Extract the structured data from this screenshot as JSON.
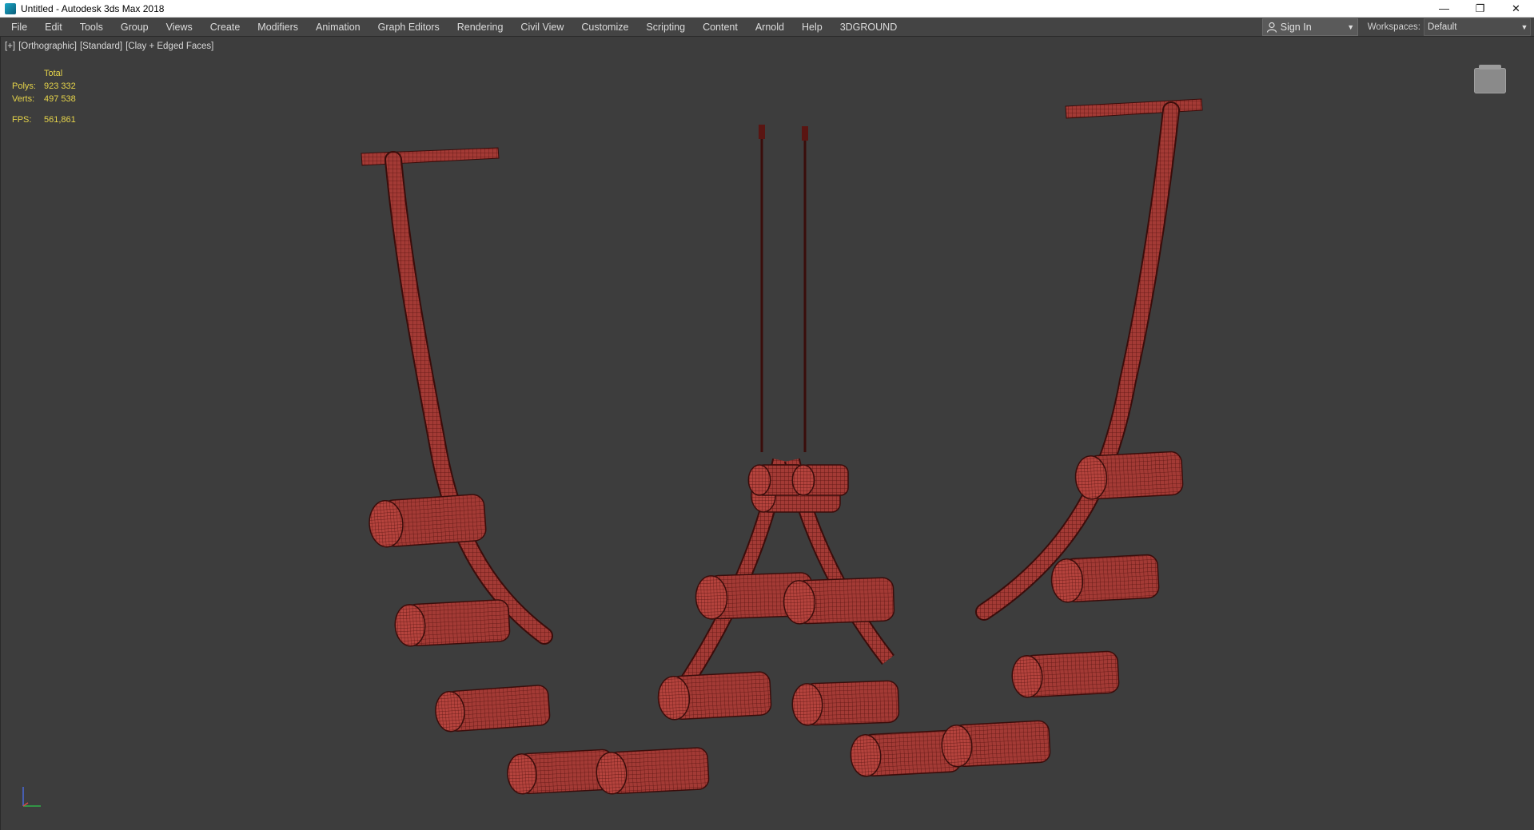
{
  "window": {
    "title": "Untitled - Autodesk 3ds Max 2018",
    "minimize": "—",
    "restore": "❐",
    "close": "✕"
  },
  "menu": {
    "items": [
      "File",
      "Edit",
      "Tools",
      "Group",
      "Views",
      "Create",
      "Modifiers",
      "Animation",
      "Graph Editors",
      "Rendering",
      "Civil View",
      "Customize",
      "Scripting",
      "Content",
      "Arnold",
      "Help",
      "3DGROUND"
    ],
    "sign_in": "Sign In",
    "workspaces_label": "Workspaces:",
    "workspace_value": "Default"
  },
  "viewport": {
    "labels": [
      "[+]",
      "[Orthographic]",
      "[Standard]",
      "[Clay + Edged Faces]"
    ],
    "stats": {
      "header": "Total",
      "polys_label": "Polys:",
      "polys_value": "923 332",
      "verts_label": "Verts:",
      "verts_value": "497 538",
      "fps_label": "FPS:",
      "fps_value": "561,861"
    },
    "object_color": "#a33a35",
    "edge_color": "#5a1512"
  }
}
